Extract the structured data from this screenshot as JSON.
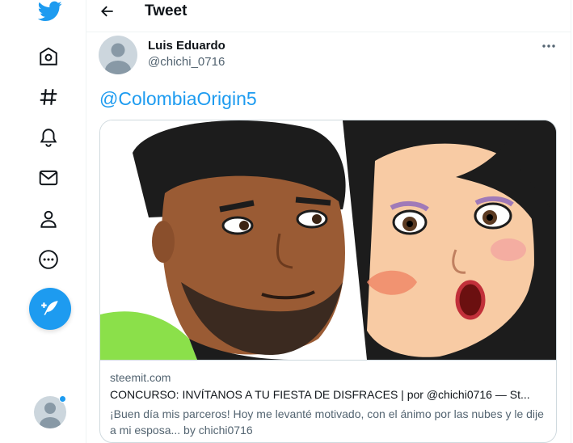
{
  "nav": {
    "items": [
      {
        "name": "twitter-logo",
        "icon": "bird-icon"
      },
      {
        "name": "home",
        "icon": "home-icon"
      },
      {
        "name": "explore",
        "icon": "hashtag-icon"
      },
      {
        "name": "notifications",
        "icon": "bell-icon"
      },
      {
        "name": "messages",
        "icon": "envelope-icon"
      },
      {
        "name": "profile",
        "icon": "person-icon"
      },
      {
        "name": "more",
        "icon": "more-circle-icon"
      }
    ],
    "compose_icon": "feather-plus-icon",
    "accent_color": "#1d9bf0"
  },
  "header": {
    "title": "Tweet"
  },
  "tweet": {
    "author_name": "Luis Eduardo",
    "author_handle": "@chichi_0716",
    "text": "@ColombiaOrigin5",
    "card": {
      "domain": "steemit.com",
      "title": "CONCURSO: INVÍTANOS A TU FIESTA DE DISFRACES | por @chichi0716 — St...",
      "description": "¡Buen día mis parceros! Hoy me levanté motivado, con el ánimo por las nubes y le dije a mi esposa... by chichi0716"
    }
  }
}
